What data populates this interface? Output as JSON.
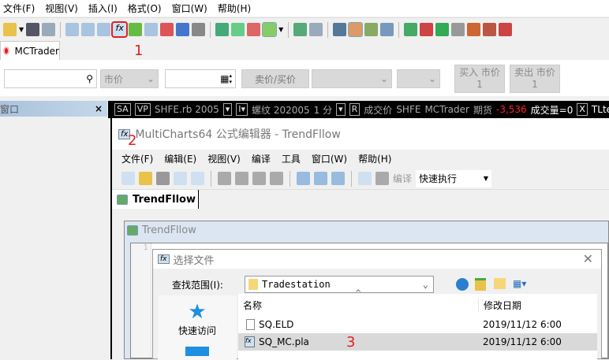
{
  "menu": [
    "文件(F)",
    "视图(V)",
    "插入(I)",
    "格式(O)",
    "窗口(W)",
    "帮助(H)"
  ],
  "annotations": {
    "step1": "1",
    "step2": "2",
    "step3": "3"
  },
  "tab": {
    "label": "MCTrader"
  },
  "trade": {
    "price_type": "市价",
    "bidask": "卖价/买价",
    "buy": "买入 市价",
    "buy_qty": "1",
    "sell": "卖出 市价",
    "sell_qty": "1"
  },
  "left_panel": {
    "title": "窗口",
    "close": "×"
  },
  "chart_header": {
    "sa": "SA",
    "vp": "VP",
    "symbol": "SHFE.rb 2005",
    "name": "螺纹 202005",
    "interval": "1 分",
    "r": "R",
    "price_field": "成交价",
    "exchange": "SHFE",
    "broker": "MCTrader",
    "type": "期货",
    "change": "-3,536",
    "volume": "成交量=0",
    "x": "X",
    "strategy": "TLtest",
    "change_color": "#ff2020"
  },
  "editor": {
    "title": "MultiCharts64 公式编辑器 - TrendFllow",
    "menu": [
      "文件(F)",
      "编辑(E)",
      "视图(V)",
      "编译",
      "工具",
      "窗口(W)",
      "帮助(H)"
    ],
    "compile_label": "编译",
    "mode": "快速执行",
    "tab": "TrendFllow",
    "doc_title": "TrendFllow",
    "line_no": "1"
  },
  "dialog": {
    "title": "选择文件",
    "lookin_label": "查找范围(I):",
    "lookin_value": "Tradestation",
    "quick_access": "快速访问",
    "col_name": "名称",
    "col_date": "修改日期",
    "files": [
      {
        "name": "SQ.ELD",
        "date": "2019/11/12 6:00"
      },
      {
        "name": "SQ_MC.pla",
        "date": "2019/11/12 6:00"
      }
    ]
  }
}
